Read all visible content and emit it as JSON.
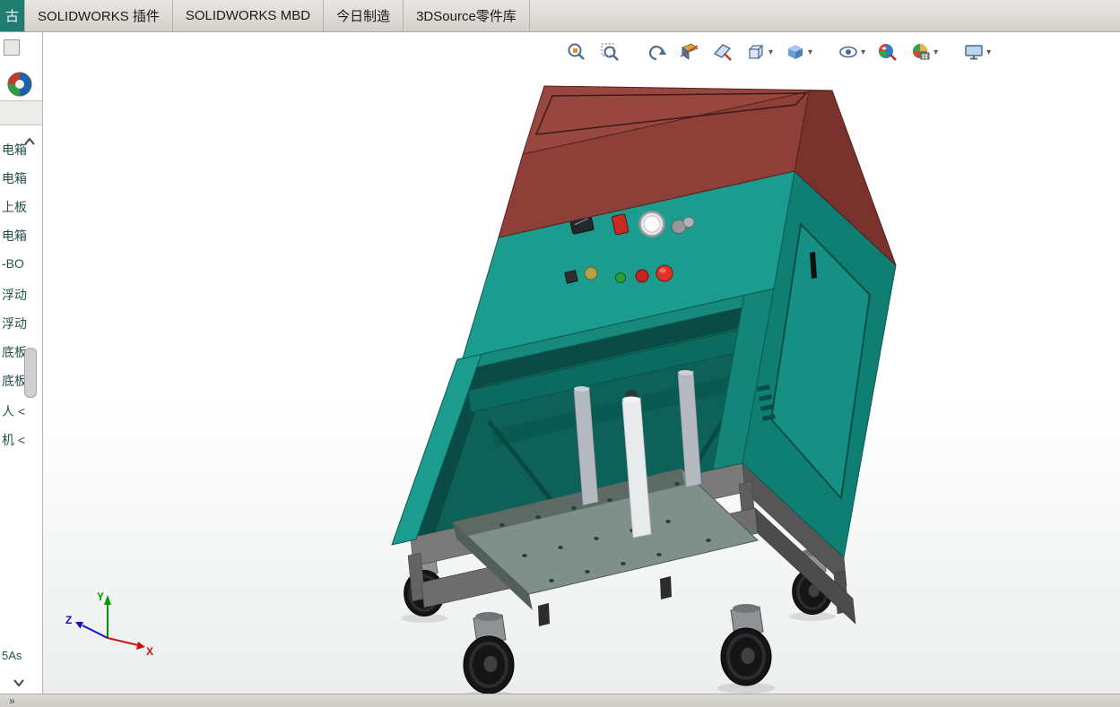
{
  "command_tabs": {
    "items": [
      {
        "label": "古"
      },
      {
        "label": "SOLIDWORKS 插件"
      },
      {
        "label": "SOLIDWORKS MBD"
      },
      {
        "label": "今日制造"
      },
      {
        "label": "3DSource零件库"
      }
    ]
  },
  "feature_tree": {
    "items": [
      "电箱",
      "电箱",
      "上板",
      "电箱",
      "-BO",
      "浮动",
      "浮动",
      "底板",
      "底板",
      "人 <",
      "机 <"
    ],
    "bottom_item": "5As",
    "scroll_up_icon": "▲",
    "scroll_down_icon": "▼"
  },
  "heads_up_toolbar": {
    "buttons": [
      {
        "name": "zoom-to-fit"
      },
      {
        "name": "zoom-to-area"
      },
      {
        "name": "previous-view"
      },
      {
        "name": "section-view"
      },
      {
        "name": "dynamic-annotation-views"
      },
      {
        "name": "view-orientation",
        "has_dropdown": true
      },
      {
        "name": "display-style",
        "has_dropdown": true
      },
      {
        "name": "hide-show-items",
        "has_dropdown": true
      },
      {
        "name": "edit-appearance"
      },
      {
        "name": "apply-scene",
        "has_dropdown": true
      },
      {
        "name": "view-settings",
        "has_dropdown": true
      }
    ],
    "dropdown_glyph": "▾"
  },
  "triad": {
    "x_label": "X",
    "y_label": "Y",
    "z_label": "Z",
    "x_color": "#cc1111",
    "y_color": "#009900",
    "z_color": "#1111cc"
  },
  "status_bar": {
    "expand_glyph": "»"
  },
  "model_colors": {
    "body_teal": "#1b9c8f",
    "body_teal_dark": "#0f7e73",
    "frame_teal": "#17897d",
    "top_red": "#8e3f37",
    "top_red_dark": "#7a332c",
    "top_red_top": "#984740",
    "base_gray": "#7a7a7a",
    "wheel_black": "#151515",
    "cylinder_gray": "#b4b8bf",
    "cylinder_white": "#e9eaec",
    "interior_dark": "#0a4b45",
    "platform_gray": "#7e9089"
  }
}
